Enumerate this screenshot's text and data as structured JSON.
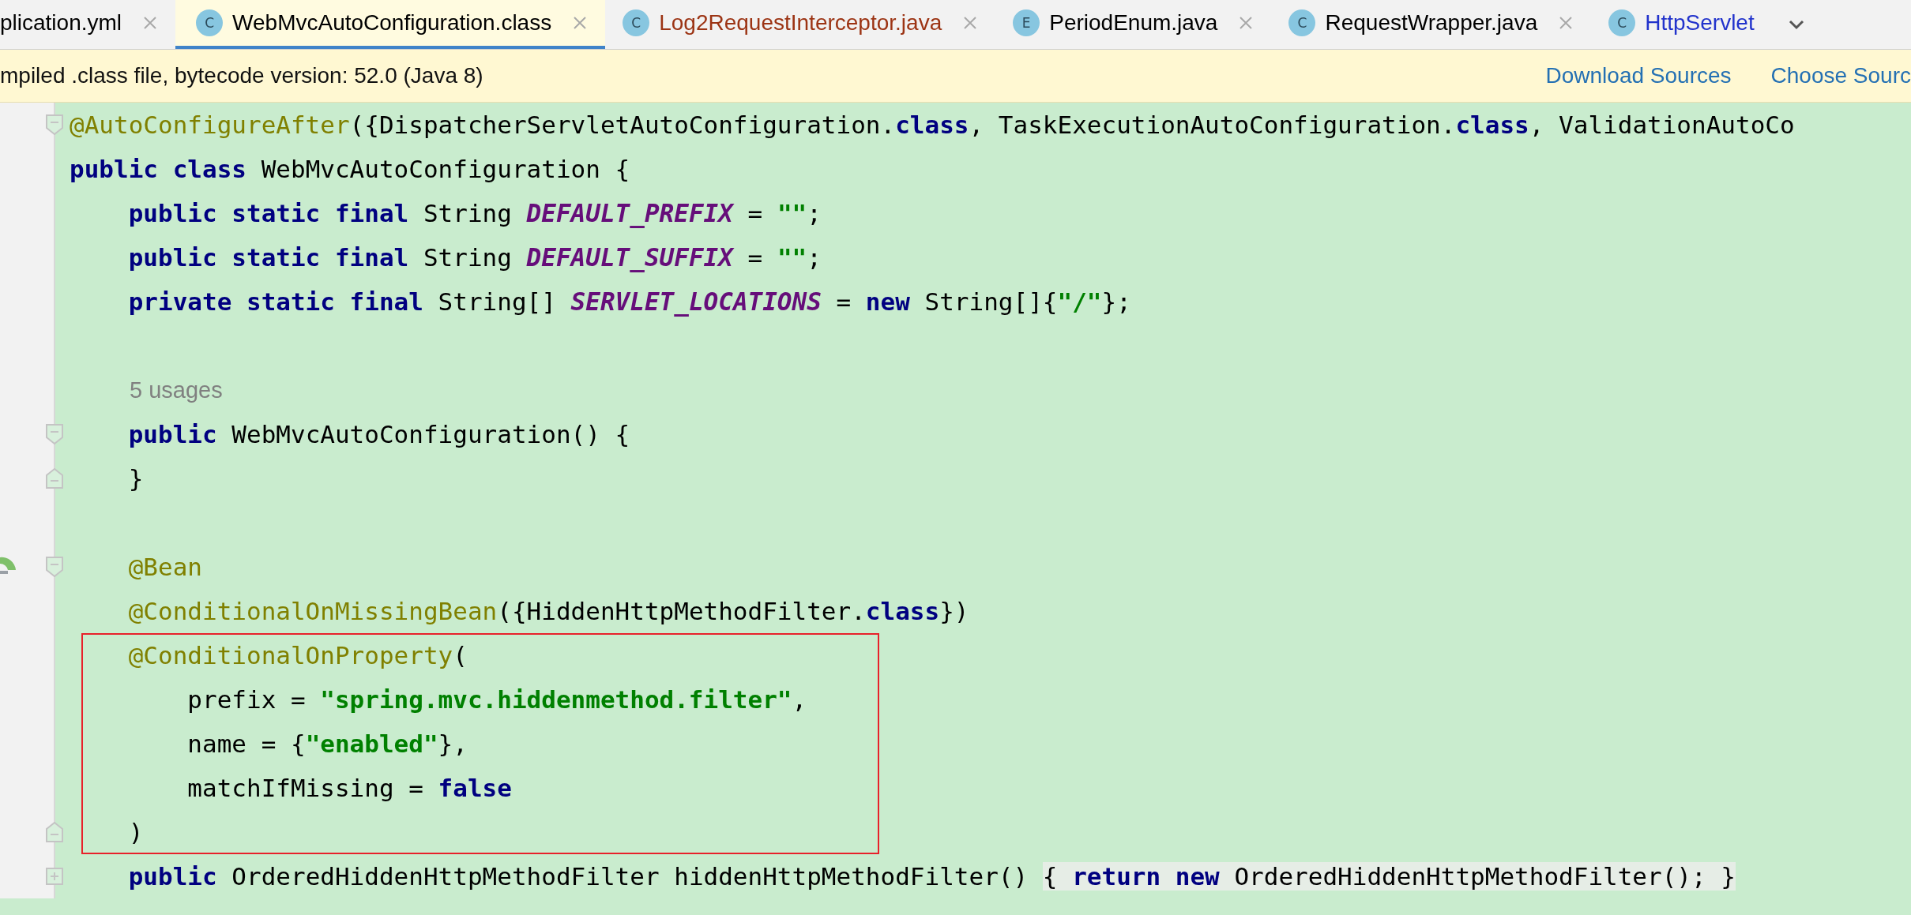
{
  "tabs": [
    {
      "label": "plication.yml",
      "selected": false,
      "closable": true,
      "color": "#000000"
    },
    {
      "label": "WebMvcAutoConfiguration.class",
      "icon_letter": "C",
      "selected": true,
      "closable": true,
      "color": "#000000"
    },
    {
      "label": "Log2RequestInterceptor.java",
      "icon_letter": "C",
      "selected": false,
      "closable": true,
      "color": "#9c3414"
    },
    {
      "label": "PeriodEnum.java",
      "icon_letter": "E",
      "selected": false,
      "closable": true,
      "color": "#000000"
    },
    {
      "label": "RequestWrapper.java",
      "icon_letter": "C",
      "selected": false,
      "closable": true,
      "color": "#000000"
    },
    {
      "label": "HttpServlet",
      "icon_letter": "C",
      "selected": false,
      "closable": false,
      "color": "#2233cc"
    }
  ],
  "banner": {
    "message": "mpiled .class file, bytecode version: 52.0 (Java 8)",
    "links": [
      "Download Sources",
      "Choose Sourc"
    ]
  },
  "code_blocks": [
    {
      "boxed": false,
      "lines": [
        {
          "kind": "fold_start",
          "tokens": [
            {
              "kind": "anno",
              "text": "@AutoConfigureAfter"
            },
            {
              "kind": "plain",
              "text": "({DispatcherServletAutoConfiguration."
            },
            {
              "kind": "kw",
              "text": "class"
            },
            {
              "kind": "plain",
              "text": ", TaskExecutionAutoConfiguration."
            },
            {
              "kind": "kw",
              "text": "class"
            },
            {
              "kind": "plain",
              "text": ", ValidationAutoCo"
            }
          ]
        },
        {
          "kind": "code",
          "tokens": [
            {
              "kind": "kw",
              "text": "public class "
            },
            {
              "kind": "plain",
              "text": "WebMvcAutoConfiguration {"
            }
          ]
        },
        {
          "kind": "code",
          "tokens": [
            {
              "kind": "kw",
              "text": "    public static final "
            },
            {
              "kind": "plain",
              "text": "String "
            },
            {
              "kind": "const",
              "text": "DEFAULT_PREFIX"
            },
            {
              "kind": "plain",
              "text": " = "
            },
            {
              "kind": "str",
              "text": "\"\""
            },
            {
              "kind": "plain",
              "text": ";"
            }
          ]
        },
        {
          "kind": "code",
          "tokens": [
            {
              "kind": "kw",
              "text": "    public static final "
            },
            {
              "kind": "plain",
              "text": "String "
            },
            {
              "kind": "const",
              "text": "DEFAULT_SUFFIX"
            },
            {
              "kind": "plain",
              "text": " = "
            },
            {
              "kind": "str",
              "text": "\"\""
            },
            {
              "kind": "plain",
              "text": ";"
            }
          ]
        },
        {
          "kind": "code",
          "tokens": [
            {
              "kind": "kw",
              "text": "    private static final "
            },
            {
              "kind": "plain",
              "text": "String[] "
            },
            {
              "kind": "const",
              "text": "SERVLET_LOCATIONS"
            },
            {
              "kind": "plain",
              "text": " = "
            },
            {
              "kind": "kw",
              "text": "new "
            },
            {
              "kind": "plain",
              "text": "String[]{"
            },
            {
              "kind": "str",
              "text": "\"/\""
            },
            {
              "kind": "plain",
              "text": "};"
            }
          ]
        },
        {
          "kind": "blank"
        },
        {
          "kind": "hint",
          "tokens": [
            {
              "kind": "hint",
              "text": "5 usages"
            }
          ]
        },
        {
          "kind": "fold_start",
          "tokens": [
            {
              "kind": "kw",
              "text": "    public "
            },
            {
              "kind": "plain",
              "text": "WebMvcAutoConfiguration() {"
            }
          ]
        },
        {
          "kind": "fold_end",
          "tokens": [
            {
              "kind": "plain",
              "text": "    }"
            }
          ]
        },
        {
          "kind": "blank"
        },
        {
          "kind": "fold_start",
          "gutter_marker": true,
          "tokens": [
            {
              "kind": "anno",
              "text": "    @Bean"
            }
          ]
        },
        {
          "kind": "code",
          "tokens": [
            {
              "kind": "anno",
              "text": "    @ConditionalOnMissingBean"
            },
            {
              "kind": "plain",
              "text": "({HiddenHttpMethodFilter."
            },
            {
              "kind": "kw",
              "text": "class"
            },
            {
              "kind": "plain",
              "text": "})"
            }
          ]
        }
      ]
    },
    {
      "boxed": true,
      "lines": [
        {
          "kind": "code",
          "tokens": [
            {
              "kind": "anno",
              "text": "    @ConditionalOnProperty"
            },
            {
              "kind": "plain",
              "text": "("
            }
          ]
        },
        {
          "kind": "code",
          "tokens": [
            {
              "kind": "plain",
              "text": "        prefix = "
            },
            {
              "kind": "str",
              "text": "\"spring.mvc.hiddenmethod.filter\""
            },
            {
              "kind": "plain",
              "text": ","
            }
          ]
        },
        {
          "kind": "code",
          "tokens": [
            {
              "kind": "plain",
              "text": "        name = {"
            },
            {
              "kind": "str",
              "text": "\"enabled\""
            },
            {
              "kind": "plain",
              "text": "},"
            }
          ]
        },
        {
          "kind": "code",
          "tokens": [
            {
              "kind": "plain",
              "text": "        matchIfMissing = "
            },
            {
              "kind": "kw",
              "text": "false"
            }
          ]
        },
        {
          "kind": "fold_end",
          "tokens": [
            {
              "kind": "plain",
              "text": "    )"
            }
          ]
        }
      ]
    },
    {
      "boxed": false,
      "lines": [
        {
          "kind": "fold_collapsed",
          "tokens": [
            {
              "kind": "kw",
              "text": "    public "
            },
            {
              "kind": "plain",
              "text": "OrderedHiddenHttpMethodFilter hiddenHttpMethodFilter() "
            },
            {
              "kind": "folded",
              "text": "{ "
            },
            {
              "kind": "folded_kw",
              "text": "return new "
            },
            {
              "kind": "folded",
              "text": "OrderedHiddenHttpMethodFilter(); }"
            }
          ]
        }
      ]
    }
  ]
}
